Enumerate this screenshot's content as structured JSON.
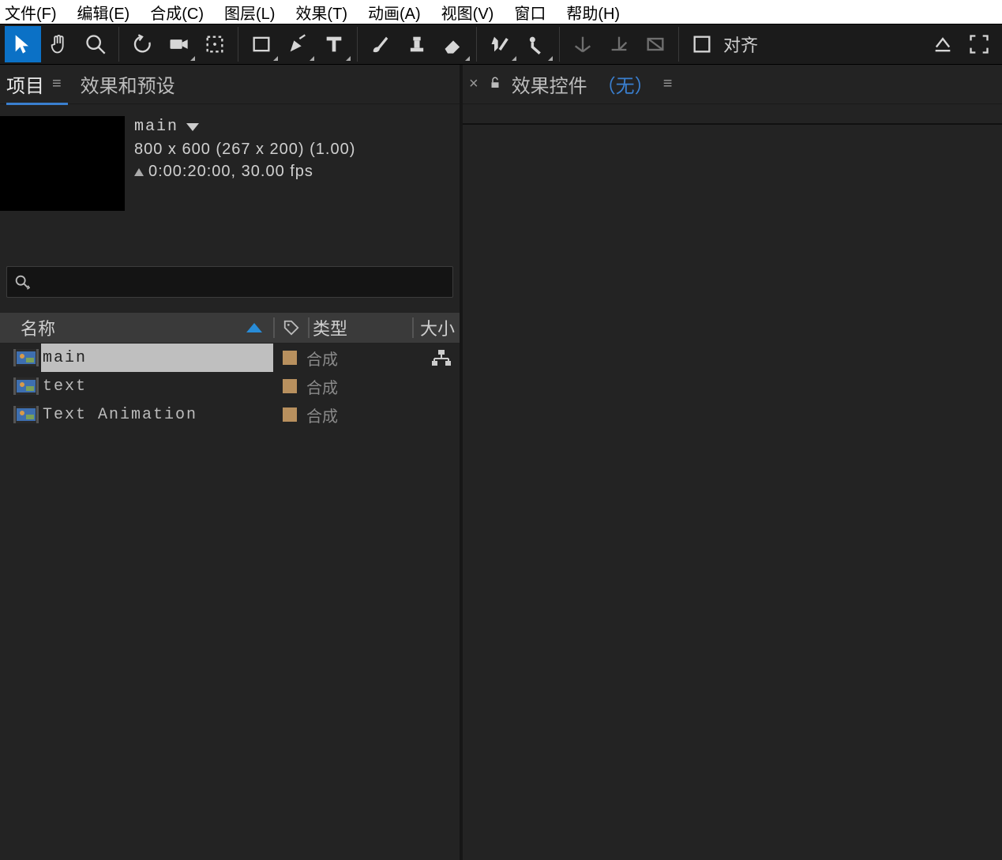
{
  "menubar": {
    "items": [
      "文件(F)",
      "编辑(E)",
      "合成(C)",
      "图层(L)",
      "效果(T)",
      "动画(A)",
      "视图(V)",
      "窗口",
      "帮助(H)"
    ]
  },
  "toolbar": {
    "align_label": "对齐"
  },
  "left_panel": {
    "tabs": {
      "project": "项目",
      "effects_presets": "效果和预设"
    },
    "comp": {
      "name": "main",
      "dimensions": "800 x 600  (267 x 200) (1.00)",
      "time_fps": "0:00:20:00, 30.00 fps"
    },
    "search_placeholder": "",
    "columns": {
      "name": "名称",
      "type": "类型",
      "size": "大小"
    },
    "assets": [
      {
        "name": "main",
        "type": "合成",
        "selected": true,
        "has_hierarchy_icon": true
      },
      {
        "name": "text",
        "type": "合成",
        "selected": false,
        "has_hierarchy_icon": false
      },
      {
        "name": "Text Animation",
        "type": "合成",
        "selected": false,
        "has_hierarchy_icon": false
      }
    ]
  },
  "right_panel": {
    "title": "效果控件",
    "none_label": "（无）"
  }
}
